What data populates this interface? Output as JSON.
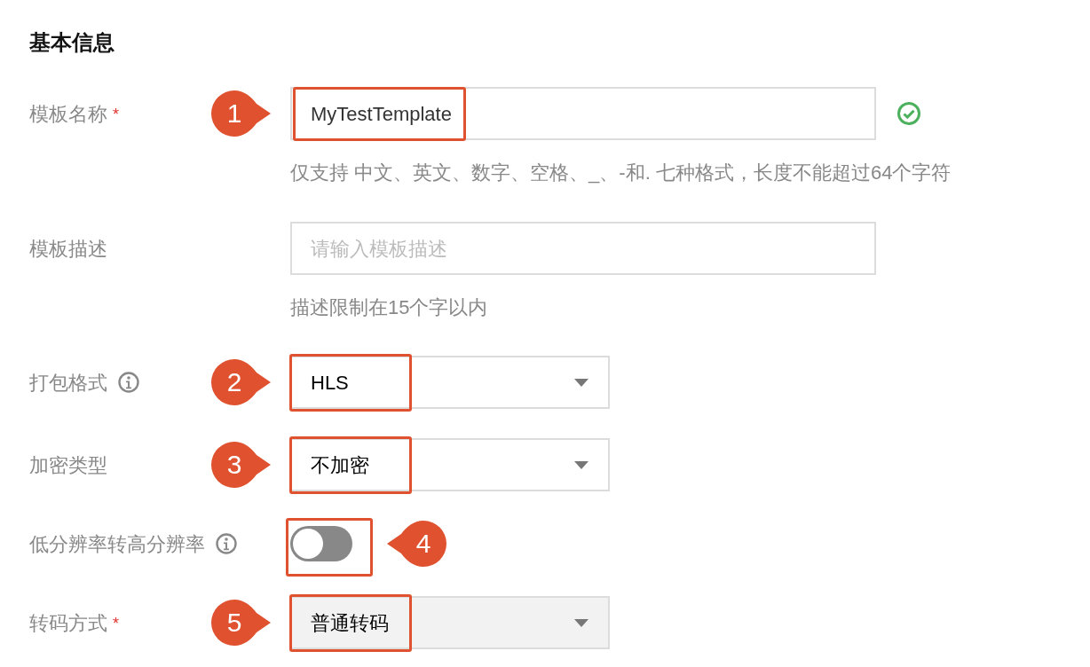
{
  "section_title": "基本信息",
  "fields": [
    {
      "kind": "text",
      "label": "模板名称",
      "required_mark": "*",
      "value": "MyTestTemplate",
      "valid": true,
      "hint": "仅支持 中文、英文、数字、空格、_、-和. 七种格式，长度不能超过64个字符",
      "callout": "1"
    },
    {
      "kind": "text",
      "label": "模板描述",
      "placeholder": "请输入模板描述",
      "hint": "描述限制在15个字以内"
    },
    {
      "kind": "select",
      "label": "打包格式",
      "info": true,
      "value": "HLS",
      "disabled": false,
      "callout": "2"
    },
    {
      "kind": "select",
      "label": "加密类型",
      "value": "不加密",
      "disabled": false,
      "callout": "3"
    },
    {
      "kind": "switch",
      "label": "低分辨率转高分辨率",
      "info": true,
      "on": false,
      "callout": "4"
    },
    {
      "kind": "select",
      "label": "转码方式",
      "required_mark": "*",
      "value": "普通转码",
      "disabled": true,
      "callout": "5"
    }
  ]
}
